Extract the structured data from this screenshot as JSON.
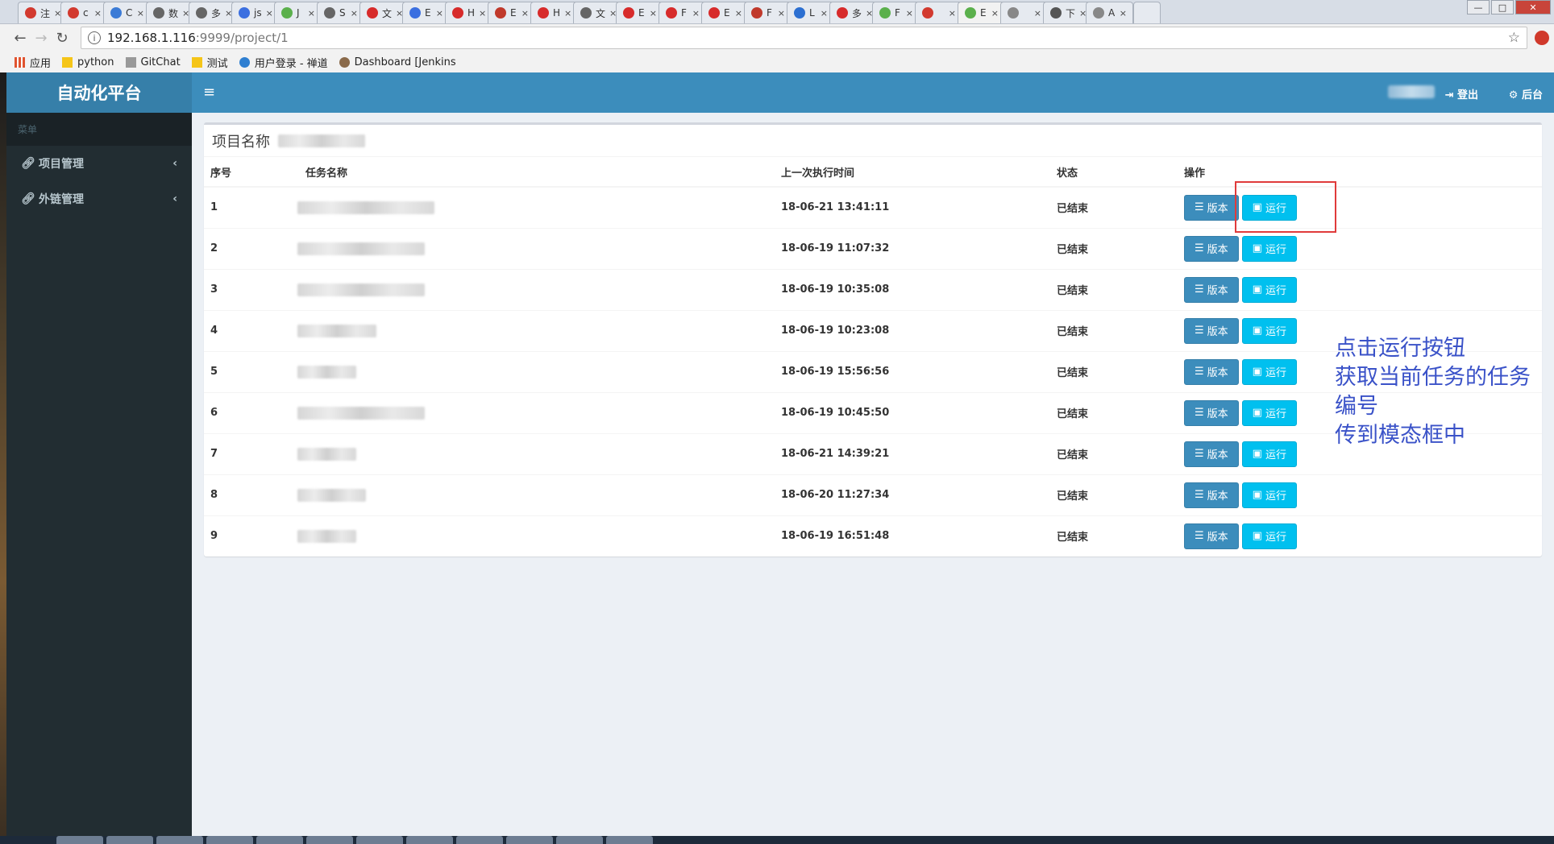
{
  "browser": {
    "tabs": [
      {
        "label": "注",
        "color": "#d23a2f"
      },
      {
        "label": "c",
        "color": "#d23a2f"
      },
      {
        "label": "C",
        "color": "#3b7bd6"
      },
      {
        "label": "数",
        "color": "#666666"
      },
      {
        "label": "多",
        "color": "#666666"
      },
      {
        "label": "js",
        "color": "#3b6fe0"
      },
      {
        "label": "J",
        "color": "#5bb04c"
      },
      {
        "label": "S",
        "color": "#666666"
      },
      {
        "label": "文",
        "color": "#d72b2b"
      },
      {
        "label": "E",
        "color": "#3b6fe0"
      },
      {
        "label": "H",
        "color": "#d72b2b"
      },
      {
        "label": "E",
        "color": "#c0392b"
      },
      {
        "label": "H",
        "color": "#d72b2b"
      },
      {
        "label": "文",
        "color": "#666666"
      },
      {
        "label": "E",
        "color": "#d72b2b"
      },
      {
        "label": "F",
        "color": "#d72b2b"
      },
      {
        "label": "E",
        "color": "#d72b2b"
      },
      {
        "label": "F",
        "color": "#c0392b"
      },
      {
        "label": "L",
        "color": "#2c6fd1"
      },
      {
        "label": "多",
        "color": "#d72b2b"
      },
      {
        "label": "F",
        "color": "#5bb04c"
      },
      {
        "label": "",
        "color": "#d23a2f"
      },
      {
        "label": "E",
        "color": "#5bb04c"
      },
      {
        "label": "",
        "color": "#888888"
      },
      {
        "label": "下",
        "color": "#555555"
      },
      {
        "label": "A",
        "color": "#888888"
      }
    ],
    "url_host": "192.168.1.116",
    "url_path": ":9999/project/1",
    "info_icon": "info-icon",
    "bookmarks": [
      {
        "label": "应用",
        "color": "#e0532f"
      },
      {
        "label": "python",
        "color": "#f5c518"
      },
      {
        "label": "GitChat",
        "color": "#999999"
      },
      {
        "label": "测试",
        "color": "#f5c518"
      },
      {
        "label": "用户登录 - 禅道",
        "color": "#2f7fd1"
      },
      {
        "label": "Dashboard [Jenkins",
        "color": "#8a6a4a"
      }
    ]
  },
  "sidebar": {
    "logo": "自动化平台",
    "menu_header": "菜单",
    "items": [
      {
        "label": "项目管理",
        "icon": "link-icon"
      },
      {
        "label": "外链管理",
        "icon": "link-icon"
      }
    ]
  },
  "topbar": {
    "menu_icon": "≡",
    "logout_label": "登出",
    "admin_label": "后台"
  },
  "main": {
    "box_title": "项目名称",
    "columns": [
      "序号",
      "任务名称",
      "上一次执行时间",
      "状态",
      "操作"
    ],
    "rows": [
      {
        "id": "1",
        "time": "18-06-21 13:41:11",
        "status": "已结束",
        "name_width": 170
      },
      {
        "id": "2",
        "time": "18-06-19 11:07:32",
        "status": "已结束",
        "name_width": 158
      },
      {
        "id": "3",
        "time": "18-06-19 10:35:08",
        "status": "已结束",
        "name_width": 158
      },
      {
        "id": "4",
        "time": "18-06-19 10:23:08",
        "status": "已结束",
        "name_width": 98
      },
      {
        "id": "5",
        "time": "18-06-19 15:56:56",
        "status": "已结束",
        "name_width": 73
      },
      {
        "id": "6",
        "time": "18-06-19 10:45:50",
        "status": "已结束",
        "name_width": 158
      },
      {
        "id": "7",
        "time": "18-06-21 14:39:21",
        "status": "已结束",
        "name_width": 73
      },
      {
        "id": "8",
        "time": "18-06-20 11:27:34",
        "status": "已结束",
        "name_width": 85
      },
      {
        "id": "9",
        "time": "18-06-19 16:51:48",
        "status": "已结束",
        "name_width": 73
      }
    ],
    "version_label": "版本",
    "run_label": "运行"
  },
  "annotation": {
    "lines": [
      "点击运行按钮",
      "获取当前任务的任务",
      "编号",
      "传到模态框中"
    ],
    "color": "#3a52c8",
    "box_color": "#e03b3b"
  }
}
